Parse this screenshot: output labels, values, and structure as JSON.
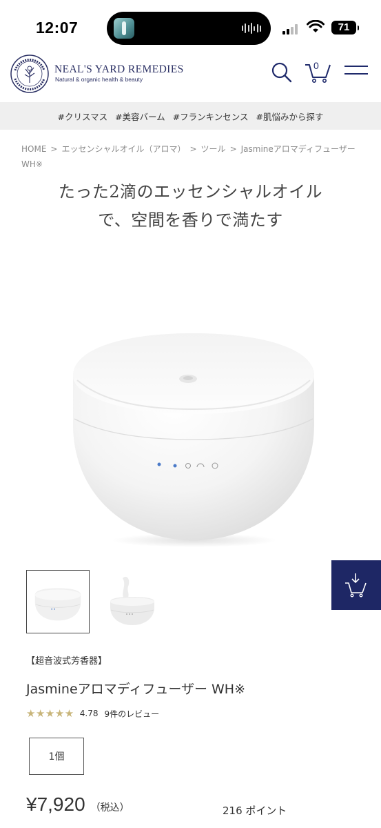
{
  "status_bar": {
    "time": "12:07",
    "battery": "71"
  },
  "header": {
    "brand_name": "NEAL'S YARD REMEDIES",
    "tagline": "Natural & organic health & beauty",
    "seal_text": "NEAL'S YARD REMEDIES COVENT GARDEN",
    "cart_count": "0"
  },
  "tags": [
    "#クリスマス",
    "#美容バーム",
    "#フランキンセンス",
    "#肌悩みから探す"
  ],
  "breadcrumb": {
    "items": [
      "HOME",
      "エッセンシャルオイル（アロマ）",
      "ツール",
      "Jasmineアロマディフューザー WH※"
    ],
    "separator": ">"
  },
  "headline": {
    "line1": "たった2滴のエッセンシャルオイル",
    "line2": "で、空間を香りで満たす"
  },
  "product": {
    "type": "【超音波式芳香器】",
    "name": "Jasmineアロマディフューザー WH※",
    "stars": "★★★★★",
    "rating": "4.78",
    "reviews": "9件のレビュー",
    "quantity": "1個",
    "price": "¥7,920",
    "tax_label": "（税込）",
    "points": "216 ポイント"
  },
  "colors": {
    "navy": "#1e2765",
    "star_gold": "#c8b57a",
    "tag_bar_bg": "#efefef"
  }
}
